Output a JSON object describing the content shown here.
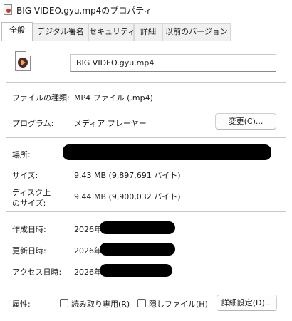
{
  "window": {
    "title": "BIG VIDEO.gyu.mp4のプロパティ",
    "icon": "video-file-icon"
  },
  "tabs": [
    {
      "label": "全般",
      "active": true
    },
    {
      "label": "デジタル署名",
      "active": false
    },
    {
      "label": "セキュリティ",
      "active": false
    },
    {
      "label": "詳細",
      "active": false
    },
    {
      "label": "以前のバージョン",
      "active": false
    }
  ],
  "general": {
    "file_name": "BIG VIDEO.gyu.mp4",
    "file_type_label": "ファイルの種類:",
    "file_type_value": "MP4 ファイル (.mp4)",
    "program_label": "プログラム:",
    "program_value": "メディア プレーヤー",
    "change_button": "変更(C)...",
    "location_label": "場所:",
    "size_label": "サイズ:",
    "size_value": "9.43 MB (9,897,691 バイト)",
    "disk_size_label": "ディスク上\nのサイズ:",
    "disk_size_value": "9.44 MB (9,900,032 バイト)",
    "created_label": "作成日時:",
    "created_value": "2026年",
    "modified_label": "更新日時:",
    "modified_value": "2026年",
    "accessed_label": "アクセス日時:",
    "accessed_value": "2026年",
    "attributes_label": "属性:",
    "readonly_label": "読み取り専用(R)",
    "readonly_checked": false,
    "hidden_label": "隠しファイル(H)",
    "hidden_checked": false,
    "advanced_button": "詳細設定(D)..."
  }
}
